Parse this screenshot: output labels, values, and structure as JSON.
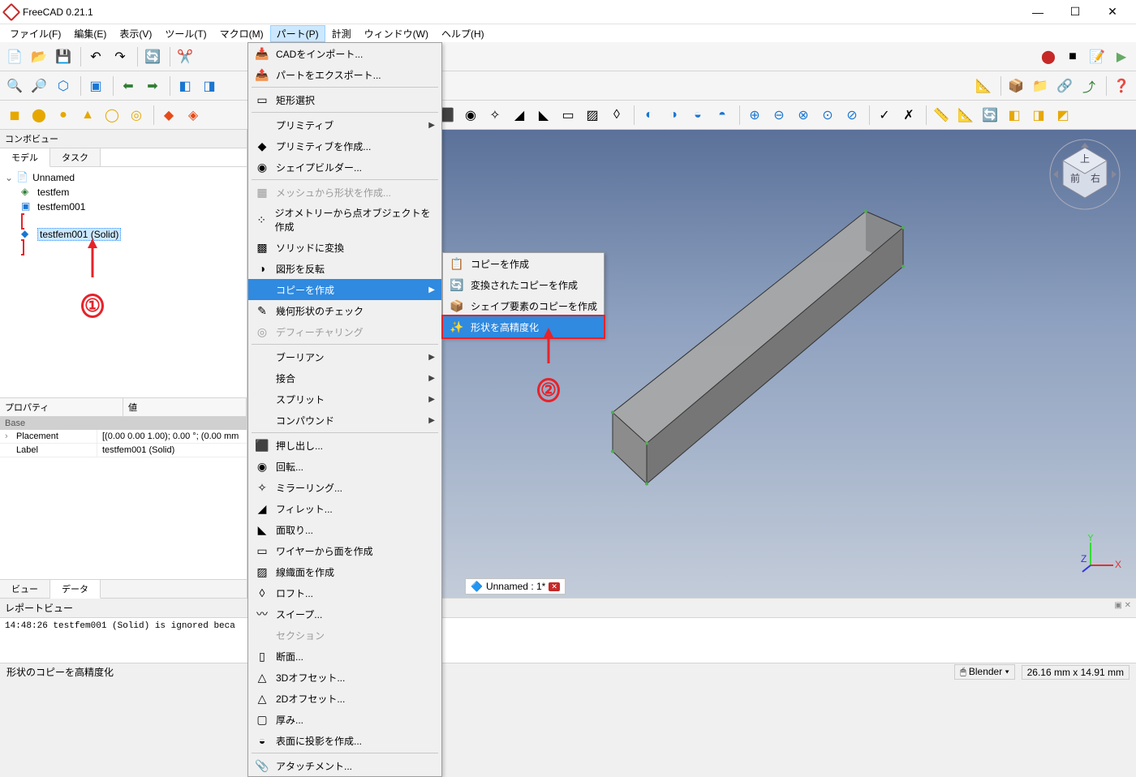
{
  "app_title": "FreeCAD 0.21.1",
  "menubar": [
    "ファイル(F)",
    "編集(E)",
    "表示(V)",
    "ツール(T)",
    "マクロ(M)",
    "パート(P)",
    "計測",
    "ウィンドウ(W)",
    "ヘルプ(H)"
  ],
  "active_menu_index": 5,
  "combo_view": {
    "title": "コンボビュー",
    "tabs": [
      "モデル",
      "タスク"
    ],
    "active_tab": 0
  },
  "tree": {
    "root": "Unnamed",
    "children": [
      {
        "label": "testfem"
      },
      {
        "label": "testfem001"
      },
      {
        "label": "testfem001 (Solid)",
        "selected": true
      }
    ]
  },
  "property": {
    "head": [
      "プロパティ",
      "値"
    ],
    "category": "Base",
    "rows": [
      {
        "k": "Placement",
        "v": "[(0.00 0.00 1.00); 0.00 °; (0.00 mm"
      },
      {
        "k": "Label",
        "v": "testfem001 (Solid)"
      }
    ]
  },
  "view_tabs": [
    "ビュー",
    "データ"
  ],
  "view_tabs_active": 1,
  "report": {
    "title": "レポートビュー",
    "line": "14:48:26  testfem001 (Solid) is ignored beca"
  },
  "statusbar": {
    "left": "形状のコピーを高精度化",
    "nav": "Blender",
    "dim": "26.16 mm x 14.91 mm"
  },
  "doc_tab": "Unnamed : 1*",
  "part_menu": [
    {
      "t": "CADをインポート...",
      "i": "📥"
    },
    {
      "t": "パートをエクスポート...",
      "i": "📤"
    },
    {
      "sep": true
    },
    {
      "t": "矩形選択",
      "i": "▭"
    },
    {
      "sep": true
    },
    {
      "t": "プリミティブ",
      "sub": true
    },
    {
      "t": "プリミティブを作成...",
      "i": "◆"
    },
    {
      "t": "シェイプビルダー...",
      "i": "◉"
    },
    {
      "sep": true
    },
    {
      "t": "メッシュから形状を作成...",
      "dis": true,
      "i": "▦"
    },
    {
      "t": "ジオメトリーから点オブジェクトを作成",
      "i": "⁘"
    },
    {
      "t": "ソリッドに変換",
      "i": "▩"
    },
    {
      "t": "図形を反転",
      "i": "◑"
    },
    {
      "t": "コピーを作成",
      "sub": true,
      "hl": true
    },
    {
      "t": "幾何形状のチェック",
      "i": "✎"
    },
    {
      "t": "デフィーチャリング",
      "dis": true,
      "i": "◎"
    },
    {
      "sep": true
    },
    {
      "t": "ブーリアン",
      "sub": true
    },
    {
      "t": "接合",
      "sub": true
    },
    {
      "t": "スプリット",
      "sub": true
    },
    {
      "t": "コンパウンド",
      "sub": true
    },
    {
      "sep": true
    },
    {
      "t": "押し出し...",
      "i": "⬛"
    },
    {
      "t": "回転...",
      "i": "◉"
    },
    {
      "t": "ミラーリング...",
      "i": "✧"
    },
    {
      "t": "フィレット...",
      "i": "◢"
    },
    {
      "t": "面取り...",
      "i": "◣"
    },
    {
      "t": "ワイヤーから面を作成",
      "i": "▭"
    },
    {
      "t": "線織面を作成",
      "i": "▨"
    },
    {
      "t": "ロフト...",
      "i": "◊"
    },
    {
      "t": "スイープ...",
      "i": "〰"
    },
    {
      "t": "セクション",
      "dis": true
    },
    {
      "t": "断面...",
      "i": "▯"
    },
    {
      "t": "3Dオフセット...",
      "i": "△"
    },
    {
      "t": "2Dオフセット...",
      "i": "△"
    },
    {
      "t": "厚み...",
      "i": "▢"
    },
    {
      "t": "表面に投影を作成...",
      "i": "◒"
    },
    {
      "sep": true
    },
    {
      "t": "アタッチメント...",
      "i": "📎"
    }
  ],
  "copy_submenu": [
    {
      "t": "コピーを作成",
      "i": "📋"
    },
    {
      "t": "変換されたコピーを作成",
      "i": "🔄"
    },
    {
      "t": "シェイプ要素のコピーを作成",
      "i": "📦"
    },
    {
      "t": "形状を高精度化",
      "i": "✨",
      "hl": true,
      "red": true
    }
  ],
  "annotations": {
    "one": "①",
    "two": "②"
  }
}
